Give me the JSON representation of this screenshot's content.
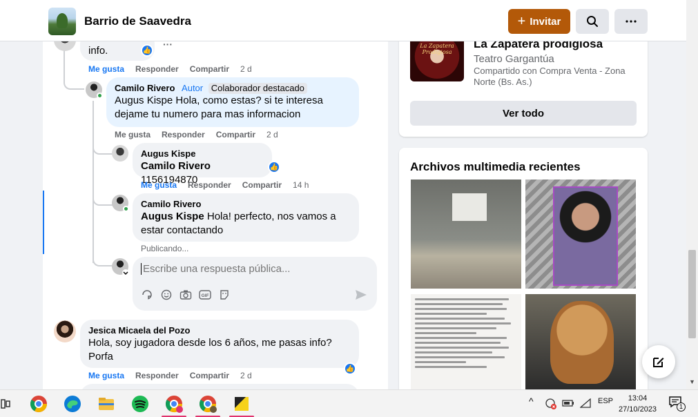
{
  "header": {
    "group_name": "Barrio de Saavedra",
    "invite_label": "Invitar"
  },
  "comments": {
    "top_fragment": {
      "text": "info.",
      "more": "···",
      "actions": {
        "like": "Me gusta",
        "reply": "Responder",
        "share": "Compartir",
        "time": "2 d"
      }
    },
    "reply1": {
      "author": "Camilo Rivero",
      "role": "Autor",
      "badge": "Colaborador destacado",
      "mention": "Augus Kispe",
      "text": " Hola, como estas? si te interesa dejame tu numero para mas informacion",
      "actions": {
        "like": "Me gusta",
        "reply": "Responder",
        "share": "Compartir",
        "time": "2 d"
      }
    },
    "reply2": {
      "author": "Augus Kispe",
      "mention": "Camilo Rivero",
      "text": " 1156194870",
      "actions": {
        "like": "Me gusta",
        "reply": "Responder",
        "share": "Compartir",
        "time": "14 h"
      }
    },
    "reply3": {
      "author": "Camilo Rivero",
      "mention": "Augus Kispe",
      "text": " Hola! perfecto, nos vamos a estar contactando",
      "status": "Publicando..."
    },
    "reply_box": {
      "placeholder": "Escribe una respuesta pública...",
      "tools": [
        "sticker-icon",
        "emoji-icon",
        "camera-icon",
        "gif-icon",
        "avatar-sticker-icon"
      ]
    },
    "comment2": {
      "author": "Jesica Micaela del Pozo",
      "text": "Hola, soy jugadora desde los 6 años, me pasas info? Porfa",
      "actions": {
        "like": "Me gusta",
        "reply": "Responder",
        "share": "Compartir",
        "time": "2 d"
      }
    }
  },
  "sidebar": {
    "event": {
      "title": "La Zapatera prodigiosa",
      "venue": "Teatro Gargantúa",
      "shared": "Compartido con Compra Venta - Zona Norte (Bs. As.)",
      "image_text": "La Zapatera Prodigiosa",
      "see_all": "Ver todo"
    },
    "media": {
      "title": "Archivos multimedia recientes",
      "items": [
        "photo-storefront",
        "photo-woman",
        "photo-text-post",
        "photo-dog"
      ]
    }
  },
  "taskbar": {
    "language": "ESP",
    "time": "13:04",
    "date": "27/10/2023",
    "notifications": "1"
  },
  "colors": {
    "brand_blue": "#1877f2",
    "invite_orange": "#b35909",
    "background": "#f0f2f5"
  }
}
